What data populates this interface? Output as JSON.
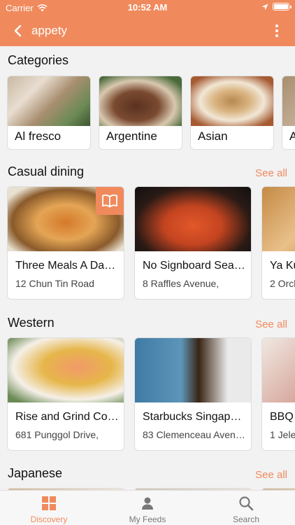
{
  "status_bar": {
    "carrier": "Carrier",
    "time": "10:52 AM"
  },
  "navbar": {
    "title": "appety"
  },
  "categories": {
    "title": "Categories",
    "items": [
      {
        "label": "Al fresco"
      },
      {
        "label": "Argentine"
      },
      {
        "label": "Asian"
      },
      {
        "label": "A"
      }
    ]
  },
  "sections": [
    {
      "title": "Casual dining",
      "see_all": "See all",
      "items": [
        {
          "name": "Three Meals A Day…",
          "address": "12 Chun Tin Road"
        },
        {
          "name": "No Signboard Seaf…",
          "address": "8 Raffles Avenue,"
        },
        {
          "name": "Ya Ku",
          "address": "2 Orch"
        }
      ]
    },
    {
      "title": "Western",
      "see_all": "See all",
      "items": [
        {
          "name": "Rise and Grind Cof…",
          "address": "681 Punggol Drive,"
        },
        {
          "name": "Starbucks Singapo…",
          "address": "83 Clemenceau Aven…"
        },
        {
          "name": "BBQ",
          "address": "1 Jele"
        }
      ]
    },
    {
      "title": "Japanese",
      "see_all": "See all",
      "items": []
    }
  ],
  "tabs": [
    {
      "label": "Discovery",
      "active": true
    },
    {
      "label": "My Feeds",
      "active": false
    },
    {
      "label": "Search",
      "active": false
    }
  ],
  "colors": {
    "accent": "#F08A5D",
    "background": "#f2f2f2"
  }
}
